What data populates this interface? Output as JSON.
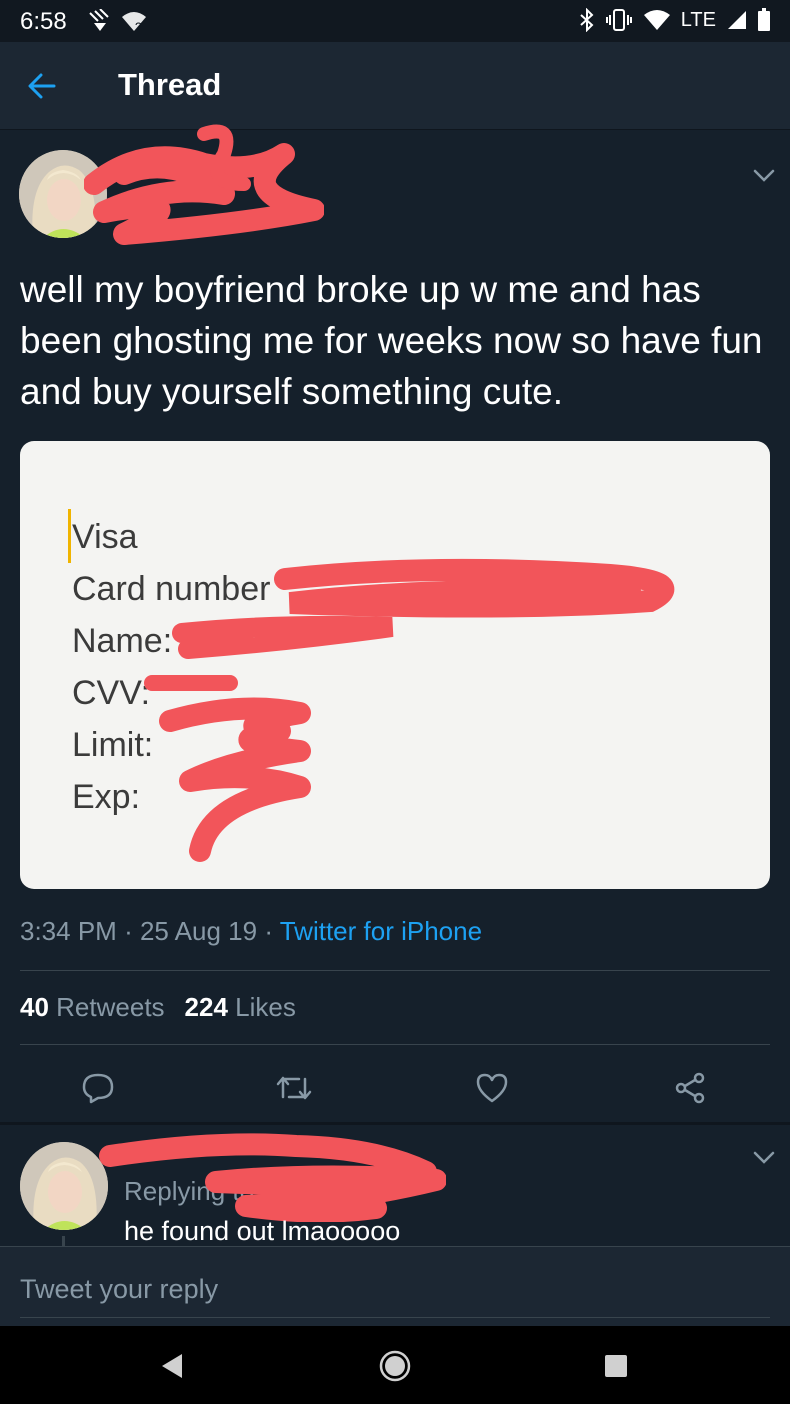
{
  "status_bar": {
    "time": "6:58",
    "network": "LTE"
  },
  "header": {
    "title": "Thread"
  },
  "tweet": {
    "text": "well my boyfriend broke up w me and has been ghosting me for weeks now so have fun and buy yourself something cute.",
    "card_image": {
      "lines": [
        "Visa",
        "Card number",
        "Name:",
        "CVV:",
        "Limit:",
        "Exp:"
      ]
    },
    "time": "3:34 PM",
    "date": "25 Aug 19",
    "source": "Twitter for iPhone",
    "retweets_count": "40",
    "retweets_label": "Retweets",
    "likes_count": "224",
    "likes_label": "Likes"
  },
  "reply": {
    "context": "Replying to",
    "text": "he found out lmaooooo"
  },
  "composer": {
    "placeholder": "Tweet your reply"
  },
  "colors": {
    "background": "#15202b",
    "header": "#1c2733",
    "accent": "#1da1f2",
    "muted": "#8899a6",
    "redaction": "#f2555a"
  },
  "icons": {
    "back": "arrow-left-icon",
    "reply": "reply-bubble-icon",
    "retweet": "retweet-icon",
    "like": "heart-icon",
    "share": "share-icon",
    "more": "chevron-down-icon"
  }
}
